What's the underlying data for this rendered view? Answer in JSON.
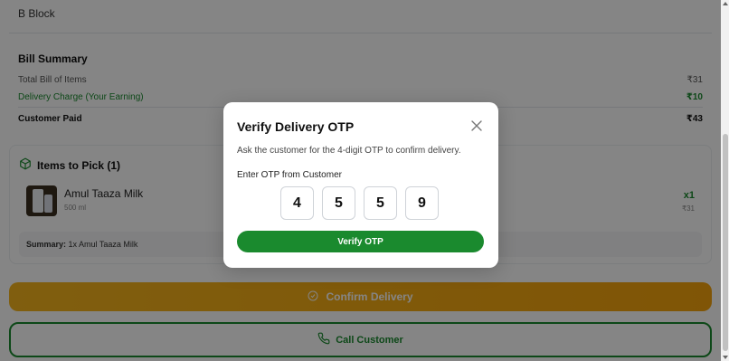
{
  "address": {
    "line": "B Block"
  },
  "bill_summary": {
    "title": "Bill Summary",
    "rows": [
      {
        "label": "Total Bill of Items",
        "value": "₹31"
      },
      {
        "label": "Delivery Charge (Your Earning)",
        "value": "₹10"
      },
      {
        "label": "Customer Paid",
        "value": "₹43"
      }
    ]
  },
  "items": {
    "header": "Items to Pick (1)",
    "list": [
      {
        "name": "Amul Taaza Milk",
        "quantity_text": "500 ml",
        "count": "x1",
        "price": "₹31"
      }
    ],
    "summary_label": "Summary:",
    "summary_text": " 1x Amul Taaza Milk"
  },
  "actions": {
    "confirm_label": "Confirm Delivery",
    "call_label": "Call Customer"
  },
  "modal": {
    "title": "Verify Delivery OTP",
    "description": "Ask the customer for the 4-digit OTP to confirm delivery.",
    "otp_label": "Enter OTP from Customer",
    "otp_digits": [
      "4",
      "5",
      "5",
      "9"
    ],
    "verify_label": "Verify OTP"
  },
  "colors": {
    "primary_green": "#1a8a2e",
    "confirm_amber": "#f5a40c"
  }
}
